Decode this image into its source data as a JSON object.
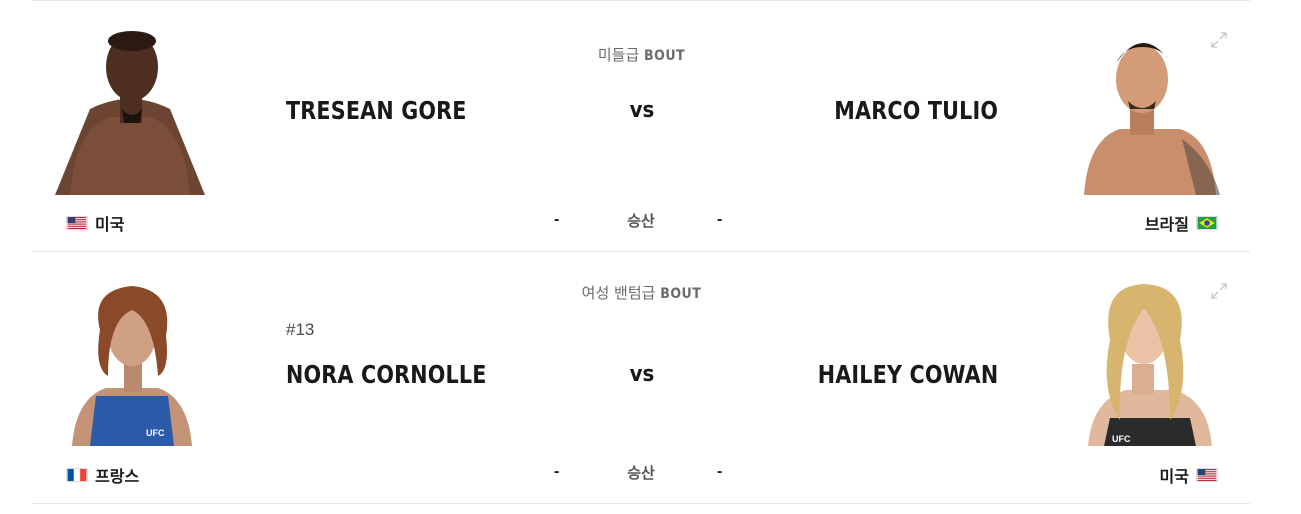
{
  "bouts": [
    {
      "weight_class": "미들급",
      "bout_word": "BOUT",
      "red": {
        "rank": "",
        "name": "TRESEAN GORE",
        "country": "미국",
        "flag": "us"
      },
      "blue": {
        "rank": "",
        "name": "MARCO TULIO",
        "country": "브라질",
        "flag": "br"
      },
      "vs": "vs",
      "odds_label": "승산",
      "red_odds": "-",
      "blue_odds": "-"
    },
    {
      "weight_class": "여성 밴텀급",
      "bout_word": "BOUT",
      "red": {
        "rank": "#13",
        "name": "NORA CORNOLLE",
        "country": "프랑스",
        "flag": "fr"
      },
      "blue": {
        "rank": "",
        "name": "HAILEY COWAN",
        "country": "미국",
        "flag": "us"
      },
      "vs": "vs",
      "odds_label": "승산",
      "red_odds": "-",
      "blue_odds": "-"
    }
  ],
  "icons": {
    "expand": "expand-icon"
  },
  "colors": {
    "text": "#191919",
    "muted": "#6b6b6b",
    "divider": "#e6e6e6",
    "icon": "#c4c4c4"
  }
}
